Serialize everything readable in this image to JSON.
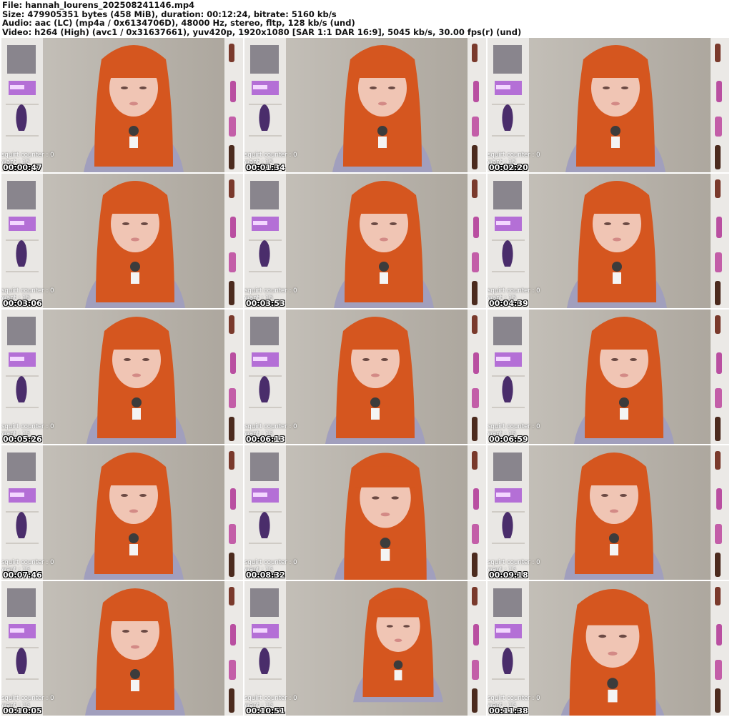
{
  "header": {
    "file_line": "File: hannah_lourens_202508241146.mp4",
    "size_line": "Size: 479905351 bytes (458 MiB), duration: 00:12:24, bitrate: 5160 kb/s",
    "audio_line": "Audio: aac (LC) (mp4a / 0x6134706D), 48000 Hz, stereo, fltp, 128 kb/s (und)",
    "video_line": "Video: h264 (High) (avc1 / 0x31637661), yuv420p, 1920x1080 [SAR 1:1 DAR 16:9], 5045 kb/s, 30.00 fps(r) (und)"
  },
  "overlay": {
    "counter_label": "squirt counter : 0",
    "want_label": "want : 15"
  },
  "colors": {
    "hair": "#d9531f",
    "hoodie": "#9e9cb8",
    "wall": "#bdb9b2",
    "shelf": "#e8e6e3",
    "skin": "#efc2b3"
  },
  "thumbnails": [
    {
      "timestamp": "00:00:47"
    },
    {
      "timestamp": "00:01:34"
    },
    {
      "timestamp": "00:02:20"
    },
    {
      "timestamp": "00:03:06"
    },
    {
      "timestamp": "00:03:53"
    },
    {
      "timestamp": "00:04:39"
    },
    {
      "timestamp": "00:05:26"
    },
    {
      "timestamp": "00:06:13"
    },
    {
      "timestamp": "00:06:59"
    },
    {
      "timestamp": "00:07:46"
    },
    {
      "timestamp": "00:08:32"
    },
    {
      "timestamp": "00:09:18"
    },
    {
      "timestamp": "00:10:05"
    },
    {
      "timestamp": "00:10:51"
    },
    {
      "timestamp": "00:11:38"
    }
  ]
}
